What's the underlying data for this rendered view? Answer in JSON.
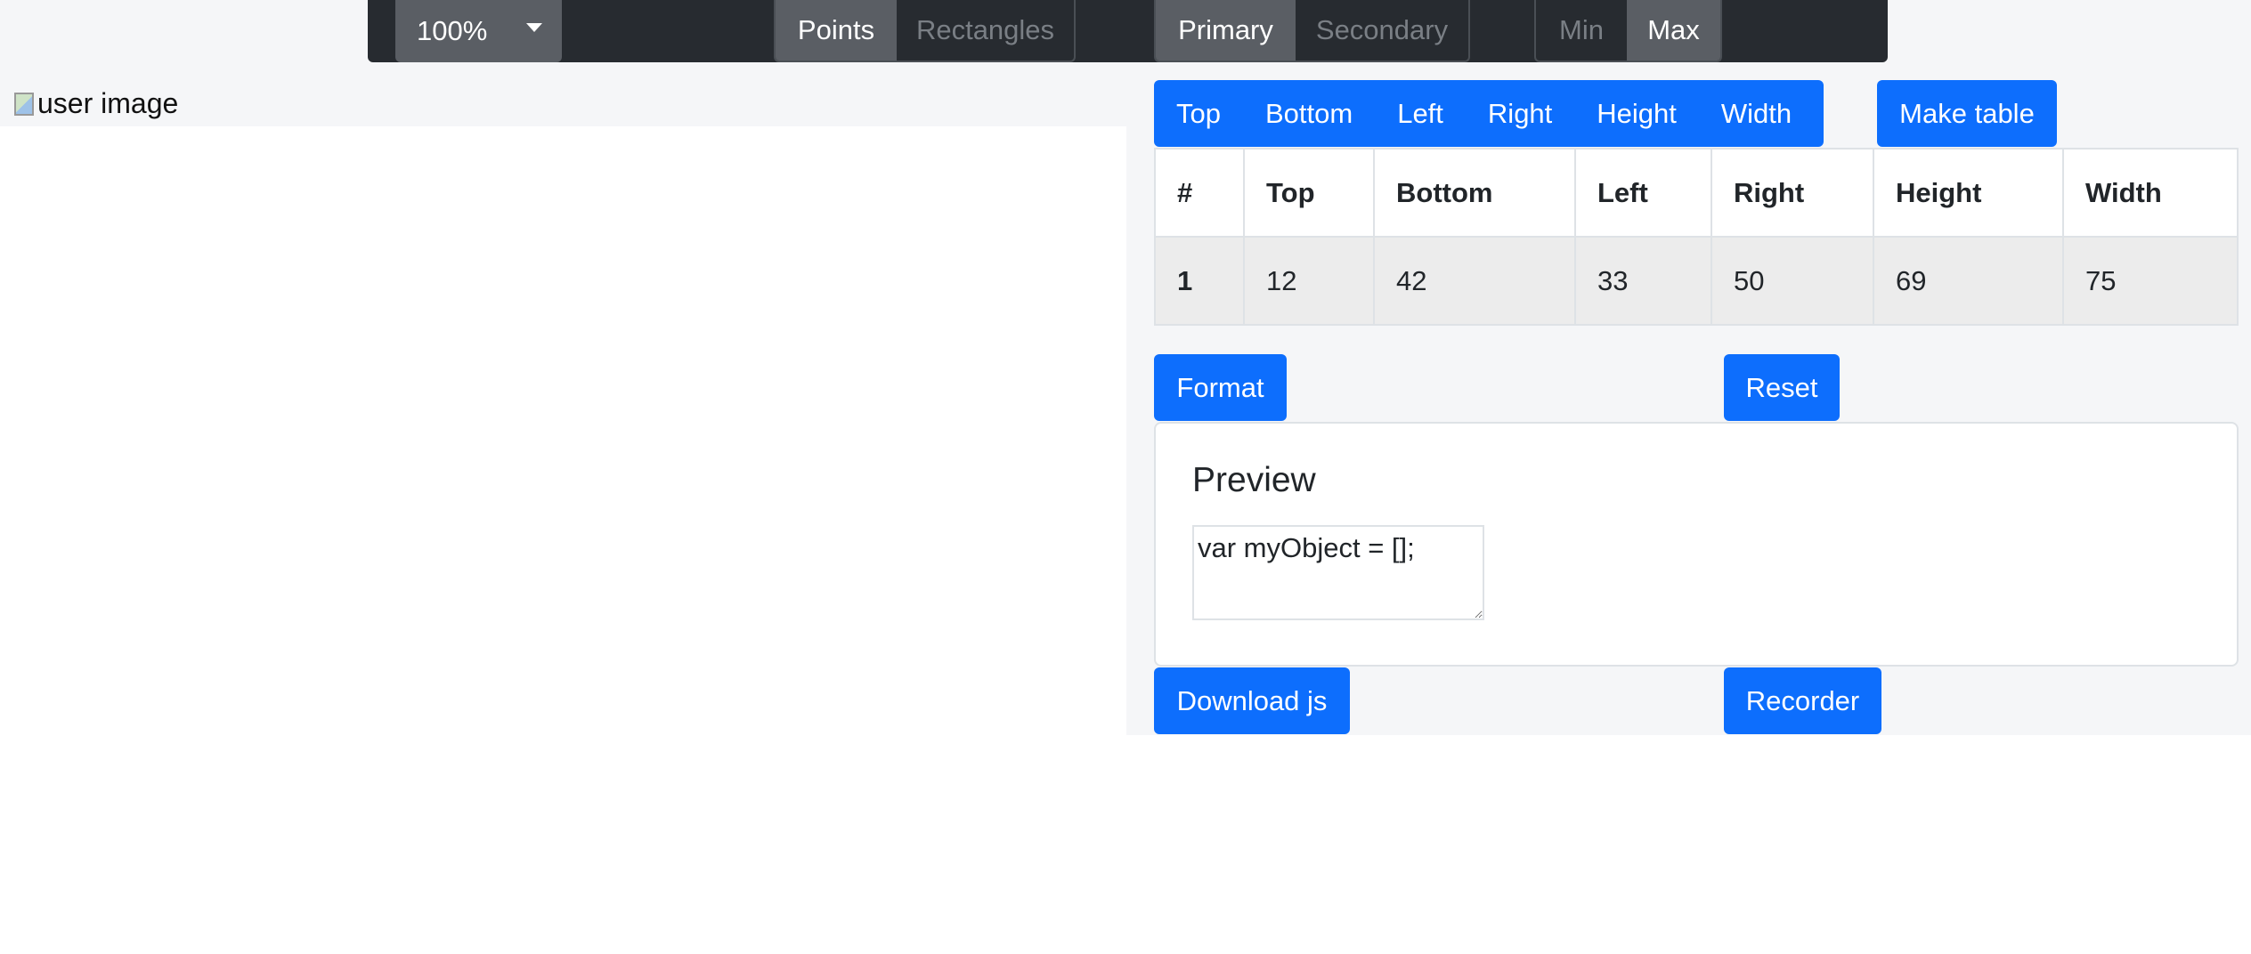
{
  "toolbar": {
    "zoom_value": "100%",
    "mode_options": [
      "Points",
      "Rectangles"
    ],
    "mode_active": "Points",
    "color_options": [
      "Primary",
      "Secondary"
    ],
    "color_active": "Primary",
    "extreme_options": [
      "Min",
      "Max"
    ],
    "extreme_active": "Max"
  },
  "image": {
    "alt": "user image"
  },
  "sort_buttons": [
    "Top",
    "Bottom",
    "Left",
    "Right",
    "Height",
    "Width"
  ],
  "make_table_label": "Make table",
  "table": {
    "headers": [
      "#",
      "Top",
      "Bottom",
      "Left",
      "Right",
      "Height",
      "Width"
    ],
    "rows": [
      [
        "1",
        "12",
        "42",
        "33",
        "50",
        "69",
        "75"
      ]
    ]
  },
  "format_label": "Format",
  "reset_label": "Reset",
  "preview": {
    "title": "Preview",
    "code": "var myObject = [];"
  },
  "download_label": "Download js",
  "recorder_label": "Recorder"
}
